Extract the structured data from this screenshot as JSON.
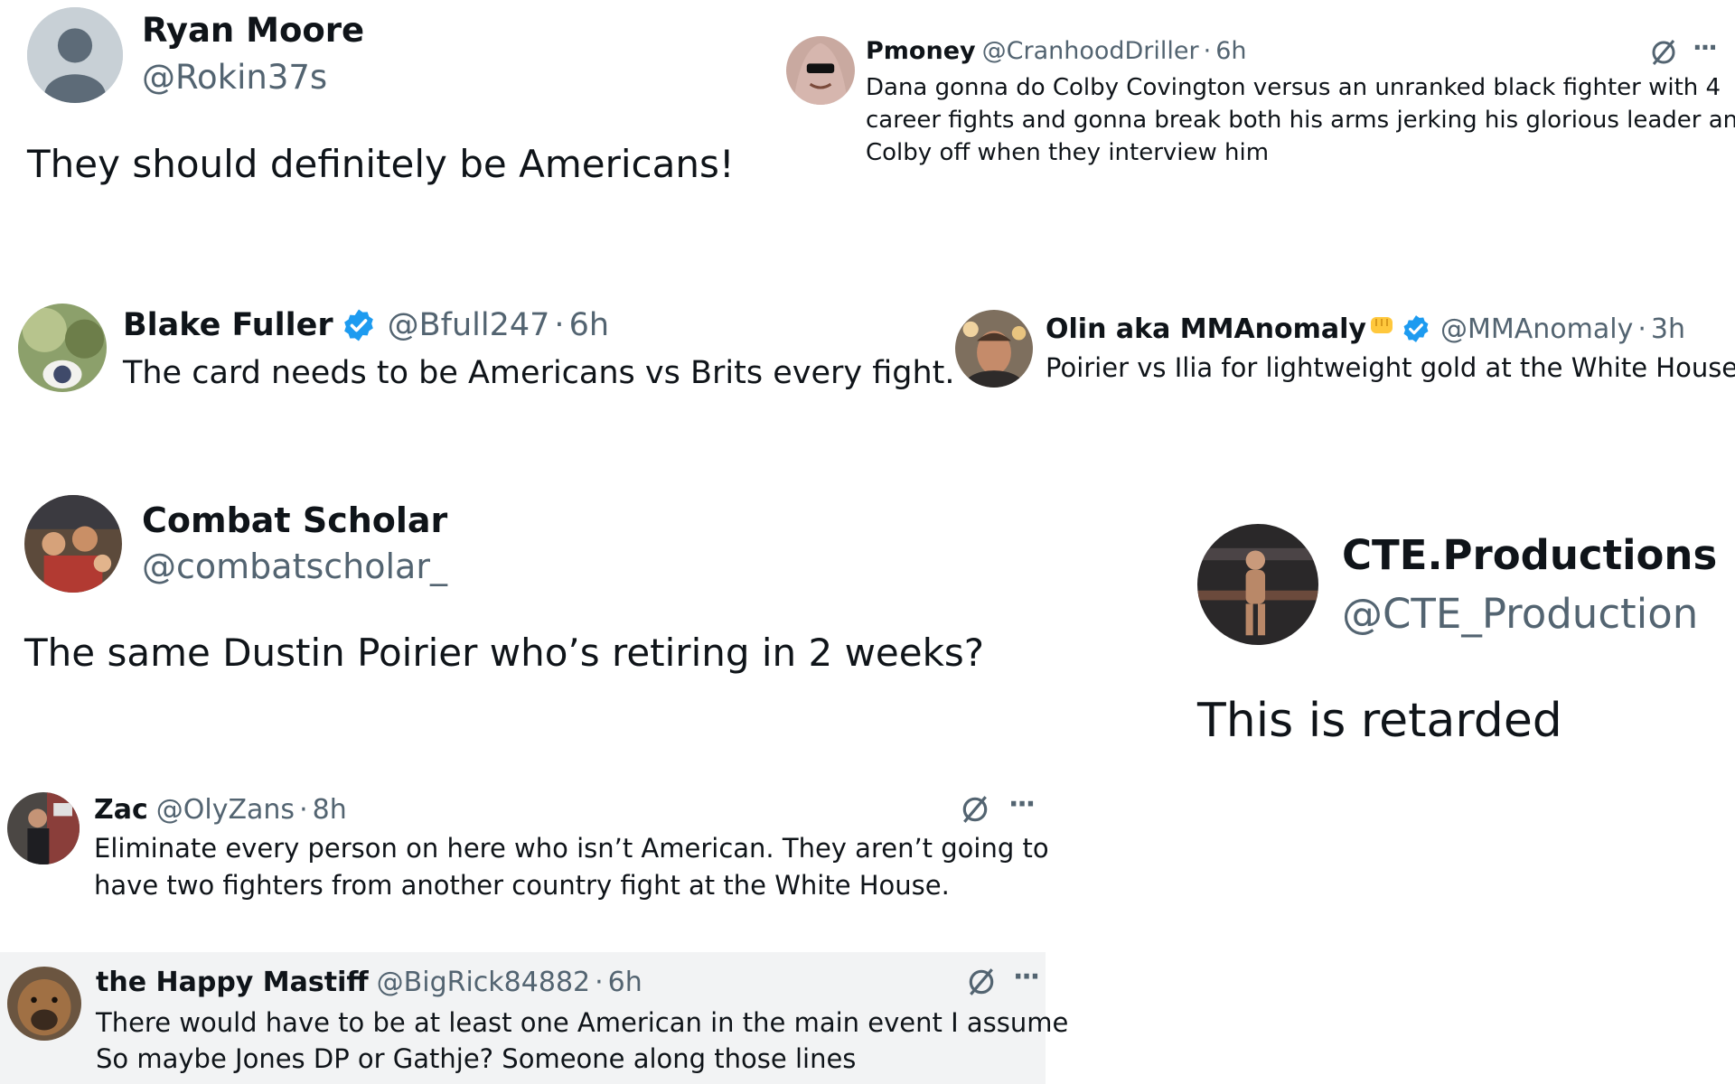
{
  "colors": {
    "text": "#0f1419",
    "muted": "#536471",
    "verified_blue": "#1d9bf0",
    "highlight_row": "#f2f3f4"
  },
  "icons": {
    "verified": "verified-badge-icon",
    "grok": "grok-icon",
    "more": "more-options-icon"
  },
  "posts": {
    "ryan": {
      "name": "Ryan Moore",
      "handle": "@Rokin37s",
      "text": "They should definitely be Americans!"
    },
    "pmoney": {
      "name": "Pmoney",
      "handle": "@CranhoodDriller",
      "sep": "·",
      "time": "6h",
      "text_line1": "Dana gonna do Colby Covington versus an unranked black fighter with 4",
      "text_line2": "career fights and gonna break both his arms jerking his glorious leader and",
      "text_line3": "Colby off when they interview him",
      "more": "···"
    },
    "blake": {
      "name": "Blake Fuller",
      "handle": "@Bfull247",
      "sep": "·",
      "time": "6h",
      "text": "The card needs to be Americans vs Brits every fight."
    },
    "olin": {
      "name": "Olin aka MMAnomaly",
      "handle": "@MMAnomaly",
      "sep": "·",
      "time": "3h",
      "text": "Poirier vs Ilia for lightweight gold at the White House?!"
    },
    "combat": {
      "name": "Combat Scholar",
      "handle": "@combatscholar_",
      "text": "The same Dustin Poirier who’s retiring in 2 weeks?"
    },
    "cte": {
      "name": "CTE.Productions",
      "handle": "@CTE_Production",
      "text": "This is retarded"
    },
    "zac": {
      "name": "Zac",
      "handle": "@OlyZans",
      "sep": "·",
      "time": "8h",
      "text_line1": "Eliminate every person on here who isn’t American. They aren’t going to",
      "text_line2": "have two fighters from another country fight at the White House.",
      "more": "···"
    },
    "mastiff": {
      "name": "the Happy Mastiff",
      "handle": "@BigRick84882",
      "sep": "·",
      "time": "6h",
      "text_line1": "There would have to be at least one American in the main event I assume",
      "text_line2": "So maybe Jones DP or Gathje? Someone along those lines",
      "more": "···"
    }
  }
}
